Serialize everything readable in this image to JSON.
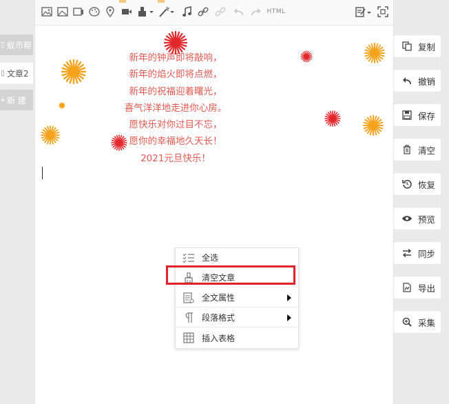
{
  "left_tabs": [
    {
      "label": "蚁币帮",
      "icon": "doc-icon",
      "state": "dark"
    },
    {
      "label": "文章2",
      "icon": "doc-icon",
      "state": "active"
    },
    {
      "label": "新 建",
      "icon": "plus-icon",
      "state": "dark"
    }
  ],
  "toolbar": {
    "html_label": "HTML",
    "icons": [
      "image-icon",
      "picture-icon",
      "gallery-icon",
      "palette-icon",
      "map-pin-icon",
      "video-icon",
      "format-brush-icon",
      "magic-wand-icon",
      "music-icon",
      "link-icon",
      "unlink-icon",
      "undo-icon",
      "redo-icon",
      "html-icon",
      "edit-icon",
      "fullscreen-icon"
    ]
  },
  "poem": [
    "新年的钟声即将敲响，",
    "新年的焰火即将点燃，",
    "新年的祝福迎着曙光，",
    "喜气洋洋地走进你心房。",
    "愿快乐对你过目不忘，",
    "愿你的幸福地久天长！",
    "2021元旦快乐！"
  ],
  "context_menu": [
    {
      "label": "全选",
      "icon": "select-all-icon",
      "submenu": false
    },
    {
      "label": "清空文章",
      "icon": "brush-icon",
      "submenu": false,
      "highlighted": true
    },
    {
      "label": "全文属性",
      "icon": "document-properties-icon",
      "submenu": true
    },
    {
      "label": "段落格式",
      "icon": "paragraph-icon",
      "submenu": true
    },
    {
      "label": "插入表格",
      "icon": "table-icon",
      "submenu": false
    }
  ],
  "right_buttons": [
    {
      "label": "复制",
      "icon": "copy-icon"
    },
    {
      "label": "撤销",
      "icon": "undo-icon"
    },
    {
      "label": "保存",
      "icon": "save-icon"
    },
    {
      "label": "清空",
      "icon": "trash-icon"
    },
    {
      "label": "恢复",
      "icon": "restore-icon"
    },
    {
      "label": "预览",
      "icon": "eye-icon"
    },
    {
      "label": "同步",
      "icon": "sync-icon"
    },
    {
      "label": "导出",
      "icon": "export-icon"
    },
    {
      "label": "采集",
      "icon": "zoom-in-icon"
    }
  ],
  "colors": {
    "poem_text": "#e05a52",
    "highlight_border": "#e0202a",
    "flower_orange": "#f5a21c",
    "flower_red": "#e2262a"
  }
}
